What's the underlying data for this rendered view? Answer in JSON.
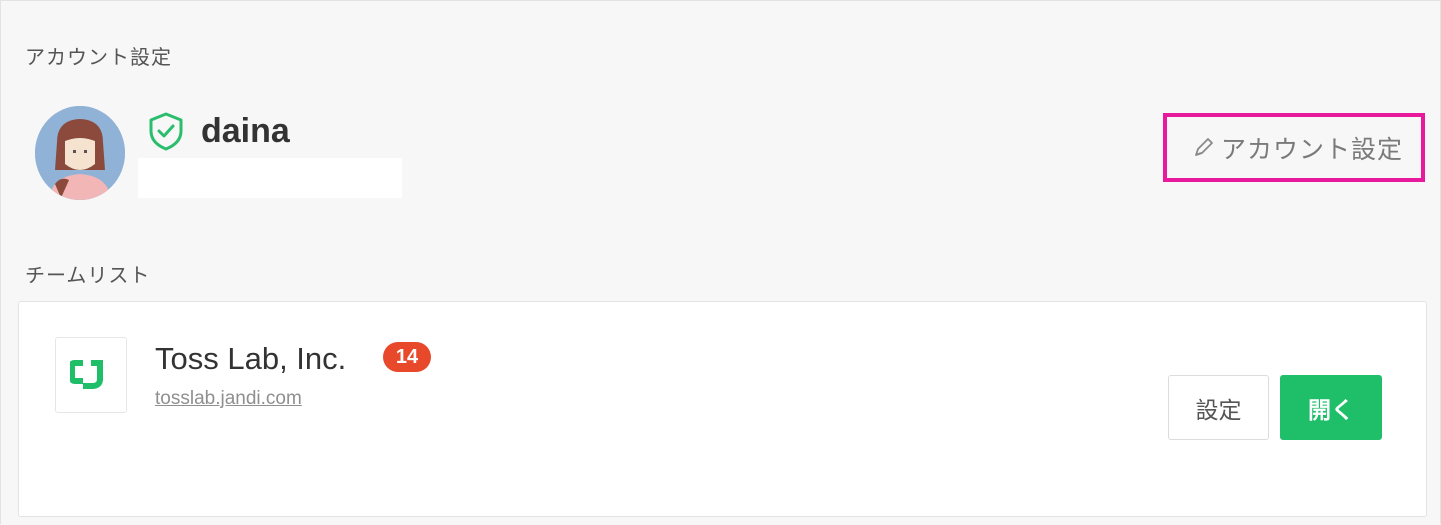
{
  "account": {
    "section_title": "アカウント設定",
    "profile_name": "daina",
    "settings_link_label": "アカウント設定"
  },
  "teams": {
    "section_title": "チームリスト",
    "items": [
      {
        "name": "Toss Lab, Inc.",
        "badge_count": "14",
        "url": "tosslab.jandi.com",
        "settings_label": "設定",
        "open_label": "開く"
      }
    ]
  },
  "icons": {
    "verified": "shield-check-icon",
    "edit": "pencil-icon",
    "team_logo": "jandi-logo-icon"
  },
  "colors": {
    "highlight_border": "#e8199c",
    "accent_green": "#1fbf6a",
    "badge_red": "#e8492a",
    "shield_green": "#2bbd6e"
  }
}
